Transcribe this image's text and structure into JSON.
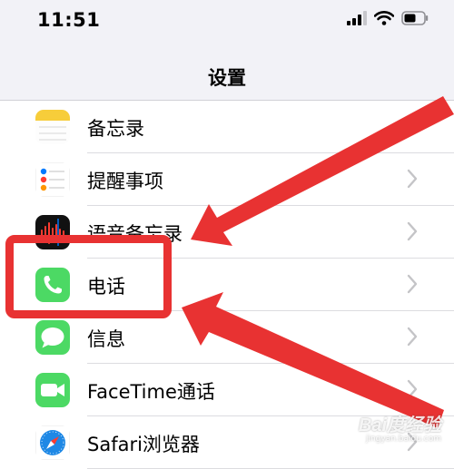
{
  "status_bar": {
    "time": "11:51"
  },
  "nav": {
    "title": "设置"
  },
  "settings_list": [
    {
      "label": "备忘录",
      "icon": "notes-icon"
    },
    {
      "label": "提醒事项",
      "icon": "reminders-icon"
    },
    {
      "label": "语音备忘录",
      "icon": "voice-memos-icon"
    },
    {
      "label": "电话",
      "icon": "phone-icon"
    },
    {
      "label": "信息",
      "icon": "messages-icon"
    },
    {
      "label": "FaceTime通话",
      "icon": "facetime-icon"
    },
    {
      "label": "Safari浏览器",
      "icon": "safari-icon"
    }
  ],
  "annotation": {
    "highlight_color": "#e83232",
    "highlighted_item": "电话"
  },
  "watermark": {
    "brand": "Bai度经验",
    "url": "jingyan.baidu.com"
  }
}
